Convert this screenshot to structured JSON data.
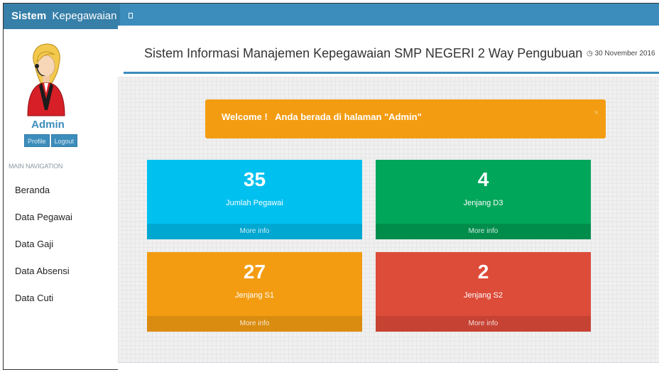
{
  "header": {
    "brand_bold": "Sistem",
    "brand_rest": "Kepegawaian",
    "toggle_icon": "sidebar-toggle-icon",
    "colors": {
      "bar": "#3c8dbc",
      "logo": "#367fa9"
    }
  },
  "sidebar": {
    "user_name": "Admin",
    "profile_label": "Profile",
    "logout_label": "Logout",
    "nav_header": "MAIN NAVIGATION",
    "items": [
      {
        "label": "Beranda"
      },
      {
        "label": "Data Pegawai"
      },
      {
        "label": "Data Gaji"
      },
      {
        "label": "Data Absensi"
      },
      {
        "label": "Data Cuti"
      }
    ]
  },
  "main": {
    "title": "Sistem Informasi Manajemen Kepegawaian SMP NEGERI 2 Way Pengubuan",
    "date": "30 November 2016",
    "alert": {
      "text": "Welcome !   Anda berada di halaman \"Admin\"",
      "close": "×",
      "color": "#f39c12"
    },
    "stats": [
      {
        "value": "35",
        "label": "Jumlah Pegawai",
        "more": "More info",
        "color": "#00c0ef"
      },
      {
        "value": "4",
        "label": "Jenjang D3",
        "more": "More info",
        "color": "#00a65a"
      },
      {
        "value": "27",
        "label": "Jenjang S1",
        "more": "More info",
        "color": "#f39c12"
      },
      {
        "value": "2",
        "label": "Jenjang S2",
        "more": "More info",
        "color": "#dd4b39"
      }
    ]
  }
}
